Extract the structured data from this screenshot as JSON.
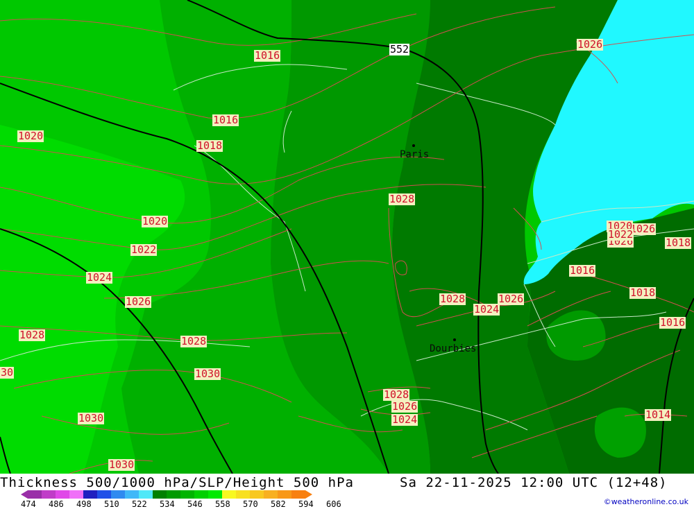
{
  "title_left": "Thickness 500/1000 hPa/SLP/Height 500 hPa",
  "title_right": "Sa 22-11-2025 12:00 UTC (12+48)",
  "credit": "©weatheronline.co.uk",
  "height_label": "552",
  "cities": [
    {
      "name": "Paris",
      "key": "paris"
    },
    {
      "name": "Dourbies",
      "key": "dourbies"
    }
  ],
  "pressure_labels": [
    "1016",
    "1016",
    "1018",
    "1020",
    "1020",
    "1022",
    "1024",
    "1026",
    "1028",
    "1028",
    "1030",
    "1030",
    "1030",
    "1028",
    "1028",
    "1024",
    "1026",
    "1028",
    "1026",
    "1024",
    "1026",
    "1016",
    "1018",
    "1016",
    "1014",
    "1026",
    "1026",
    "1018",
    "1020",
    "1022",
    "30"
  ],
  "scale": {
    "ticks": [
      "474",
      "486",
      "498",
      "510",
      "522",
      "534",
      "546",
      "558",
      "570",
      "582",
      "594",
      "606"
    ],
    "colors": [
      "#9a2fa8",
      "#c03cc8",
      "#e048e8",
      "#f070f8",
      "#2020c0",
      "#2050e8",
      "#2f8af0",
      "#40b8f8",
      "#50e8f8",
      "#008000",
      "#009a00",
      "#00b400",
      "#00d000",
      "#00ea00",
      "#f8f820",
      "#f8e020",
      "#f8c820",
      "#f8b020",
      "#f89818",
      "#f88010"
    ]
  },
  "colors": {
    "green_dark": "#007400",
    "green_mid": "#009000",
    "green_light": "#00c000",
    "green_bright": "#00d400",
    "sea": "#20f8ff",
    "isobar": "#d05050"
  }
}
